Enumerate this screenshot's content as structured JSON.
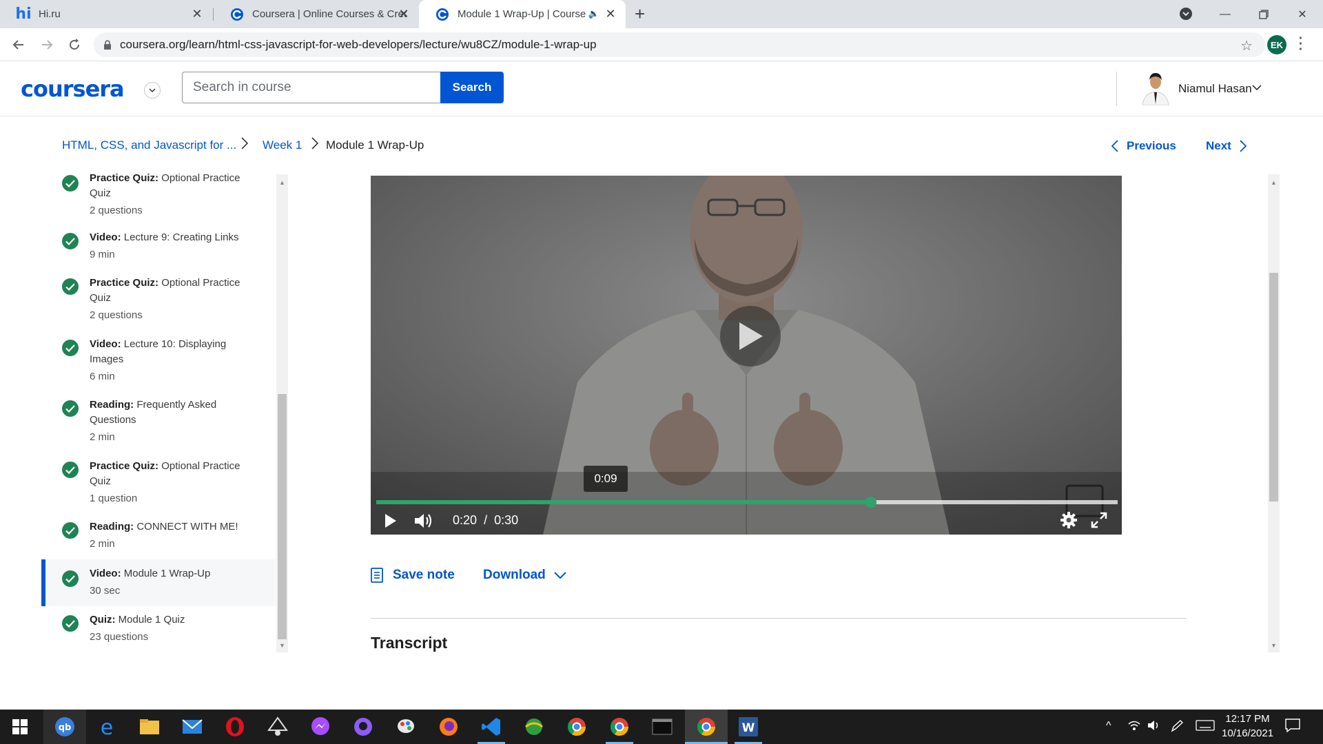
{
  "browser": {
    "tabs": [
      {
        "title": "Hi.ru",
        "favicon": "hi"
      },
      {
        "title": "Coursera | Online Courses & Cred",
        "favicon": "coursera"
      },
      {
        "title": "Module 1 Wrap-Up | Course",
        "favicon": "coursera",
        "active": true
      }
    ],
    "url": "coursera.org/learn/html-css-javascript-for-web-developers/lecture/wu8CZ/module-1-wrap-up",
    "profile_initials": "EK"
  },
  "header": {
    "logo": "coursera",
    "search_placeholder": "Search in course",
    "search_button": "Search",
    "user_name": "Niamul Hasan"
  },
  "breadcrumb": {
    "course": "HTML, CSS, and Javascript for ...",
    "week": "Week 1",
    "current": "Module 1 Wrap-Up",
    "previous": "Previous",
    "next": "Next"
  },
  "sidebar": {
    "items": [
      {
        "type": "Practice Quiz:",
        "title": "Optional Practice Quiz",
        "meta": "2 questions",
        "completed": true
      },
      {
        "type": "Video:",
        "title": "Lecture 9: Creating Links",
        "meta": "9 min",
        "completed": true
      },
      {
        "type": "Practice Quiz:",
        "title": "Optional Practice Quiz",
        "meta": "2 questions",
        "completed": true
      },
      {
        "type": "Video:",
        "title": "Lecture 10: Displaying Images",
        "meta": "6 min",
        "completed": true
      },
      {
        "type": "Reading:",
        "title": "Frequently Asked Questions",
        "meta": "2 min",
        "completed": true
      },
      {
        "type": "Practice Quiz:",
        "title": "Optional Practice Quiz",
        "meta": "1 question",
        "completed": true
      },
      {
        "type": "Reading:",
        "title": "CONNECT WITH ME!",
        "meta": "2 min",
        "completed": true
      },
      {
        "type": "Video:",
        "title": "Module 1 Wrap-Up",
        "meta": "30 sec",
        "completed": true,
        "active": true
      },
      {
        "type": "Quiz:",
        "title": "Module 1 Quiz",
        "meta": "23 questions",
        "completed": true
      }
    ]
  },
  "player": {
    "hover_time": "0:09",
    "current_time": "0:20",
    "time_separator": "/",
    "duration": "0:30",
    "progress_fraction": 0.667
  },
  "actions": {
    "save_note": "Save note",
    "download": "Download"
  },
  "transcript": {
    "heading": "Transcript"
  },
  "taskbar": {
    "time": "12:17 PM",
    "date": "10/16/2021"
  },
  "colors": {
    "brand": "#0056d2",
    "complete": "#1f8354",
    "progress": "#2fa36b"
  }
}
